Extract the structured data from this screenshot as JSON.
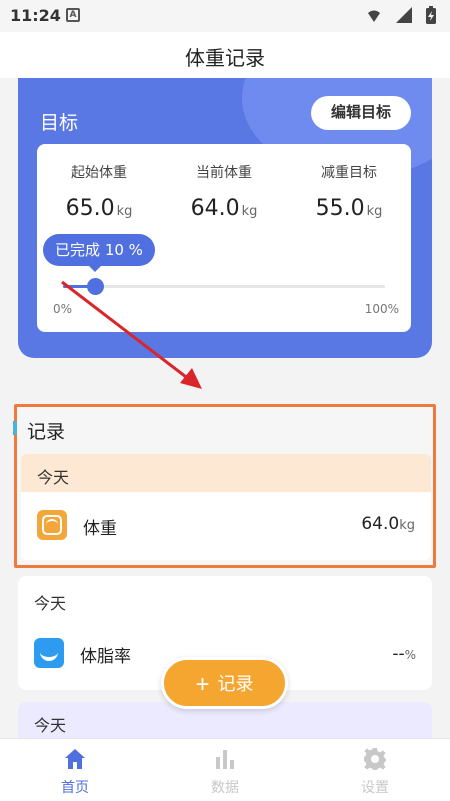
{
  "status_bar": {
    "time": "11:24",
    "notification_badge": "A"
  },
  "title": "体重记录",
  "goal": {
    "label": "目标",
    "edit_button": "编辑目标",
    "start": {
      "label": "起始体重",
      "value": "65.0",
      "unit": "kg"
    },
    "current": {
      "label": "当前体重",
      "value": "64.0",
      "unit": "kg"
    },
    "target": {
      "label": "减重目标",
      "value": "55.0",
      "unit": "kg"
    },
    "progress": {
      "text": "已完成 10 %",
      "percent": 10,
      "min_label": "0%",
      "max_label": "100%"
    }
  },
  "records": {
    "header": "记录",
    "day": "今天",
    "item": {
      "icon": "scale-icon",
      "name": "体重",
      "value": "64.0",
      "unit": "kg"
    }
  },
  "card2": {
    "day": "今天",
    "item": {
      "icon": "body-fat-icon",
      "name": "体脂率",
      "value": "--",
      "unit": "%"
    }
  },
  "card3": {
    "day": "今天"
  },
  "fab": {
    "label": "记录",
    "icon": "plus-icon"
  },
  "nav": {
    "items": [
      {
        "label": "首页",
        "icon": "home-icon",
        "active": true
      },
      {
        "label": "数据",
        "icon": "bar-chart-icon",
        "active": false
      },
      {
        "label": "设置",
        "icon": "gear-icon",
        "active": false
      }
    ]
  },
  "colors": {
    "primary": "#5a78e4",
    "accent_orange": "#f4a631",
    "highlight_border": "#f07a3d",
    "nav_active": "#4f70de",
    "nav_inactive": "#c8c8c8"
  }
}
